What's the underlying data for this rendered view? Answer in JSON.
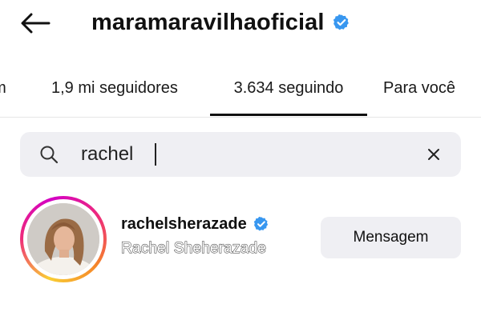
{
  "header": {
    "title": "maramaravilhaoficial",
    "back_icon": "arrow-left-icon",
    "verified_icon": "verified-badge-icon",
    "verified_color": "#3897f0"
  },
  "tabs": [
    {
      "label": "um",
      "active": false
    },
    {
      "label": "1,9 mi seguidores",
      "active": false
    },
    {
      "label": "3.634 seguindo",
      "active": true
    },
    {
      "label": "Para você",
      "active": false
    }
  ],
  "search": {
    "value": "rachel",
    "placeholder": "",
    "search_icon": "search-icon",
    "clear_icon": "close-icon"
  },
  "results": [
    {
      "username": "rachelsherazade",
      "full_name": "Rachel Sheherazade",
      "verified": true,
      "story_ring": true,
      "button_label": "Mensagem"
    }
  ],
  "colors": {
    "background": "#ffffff",
    "search_bg": "#efeff3",
    "button_bg": "#efeff3",
    "verified": "#3897f0",
    "ring_start": "#f9ce34",
    "ring_mid": "#ee2a7b",
    "ring_end": "#d300c5"
  }
}
